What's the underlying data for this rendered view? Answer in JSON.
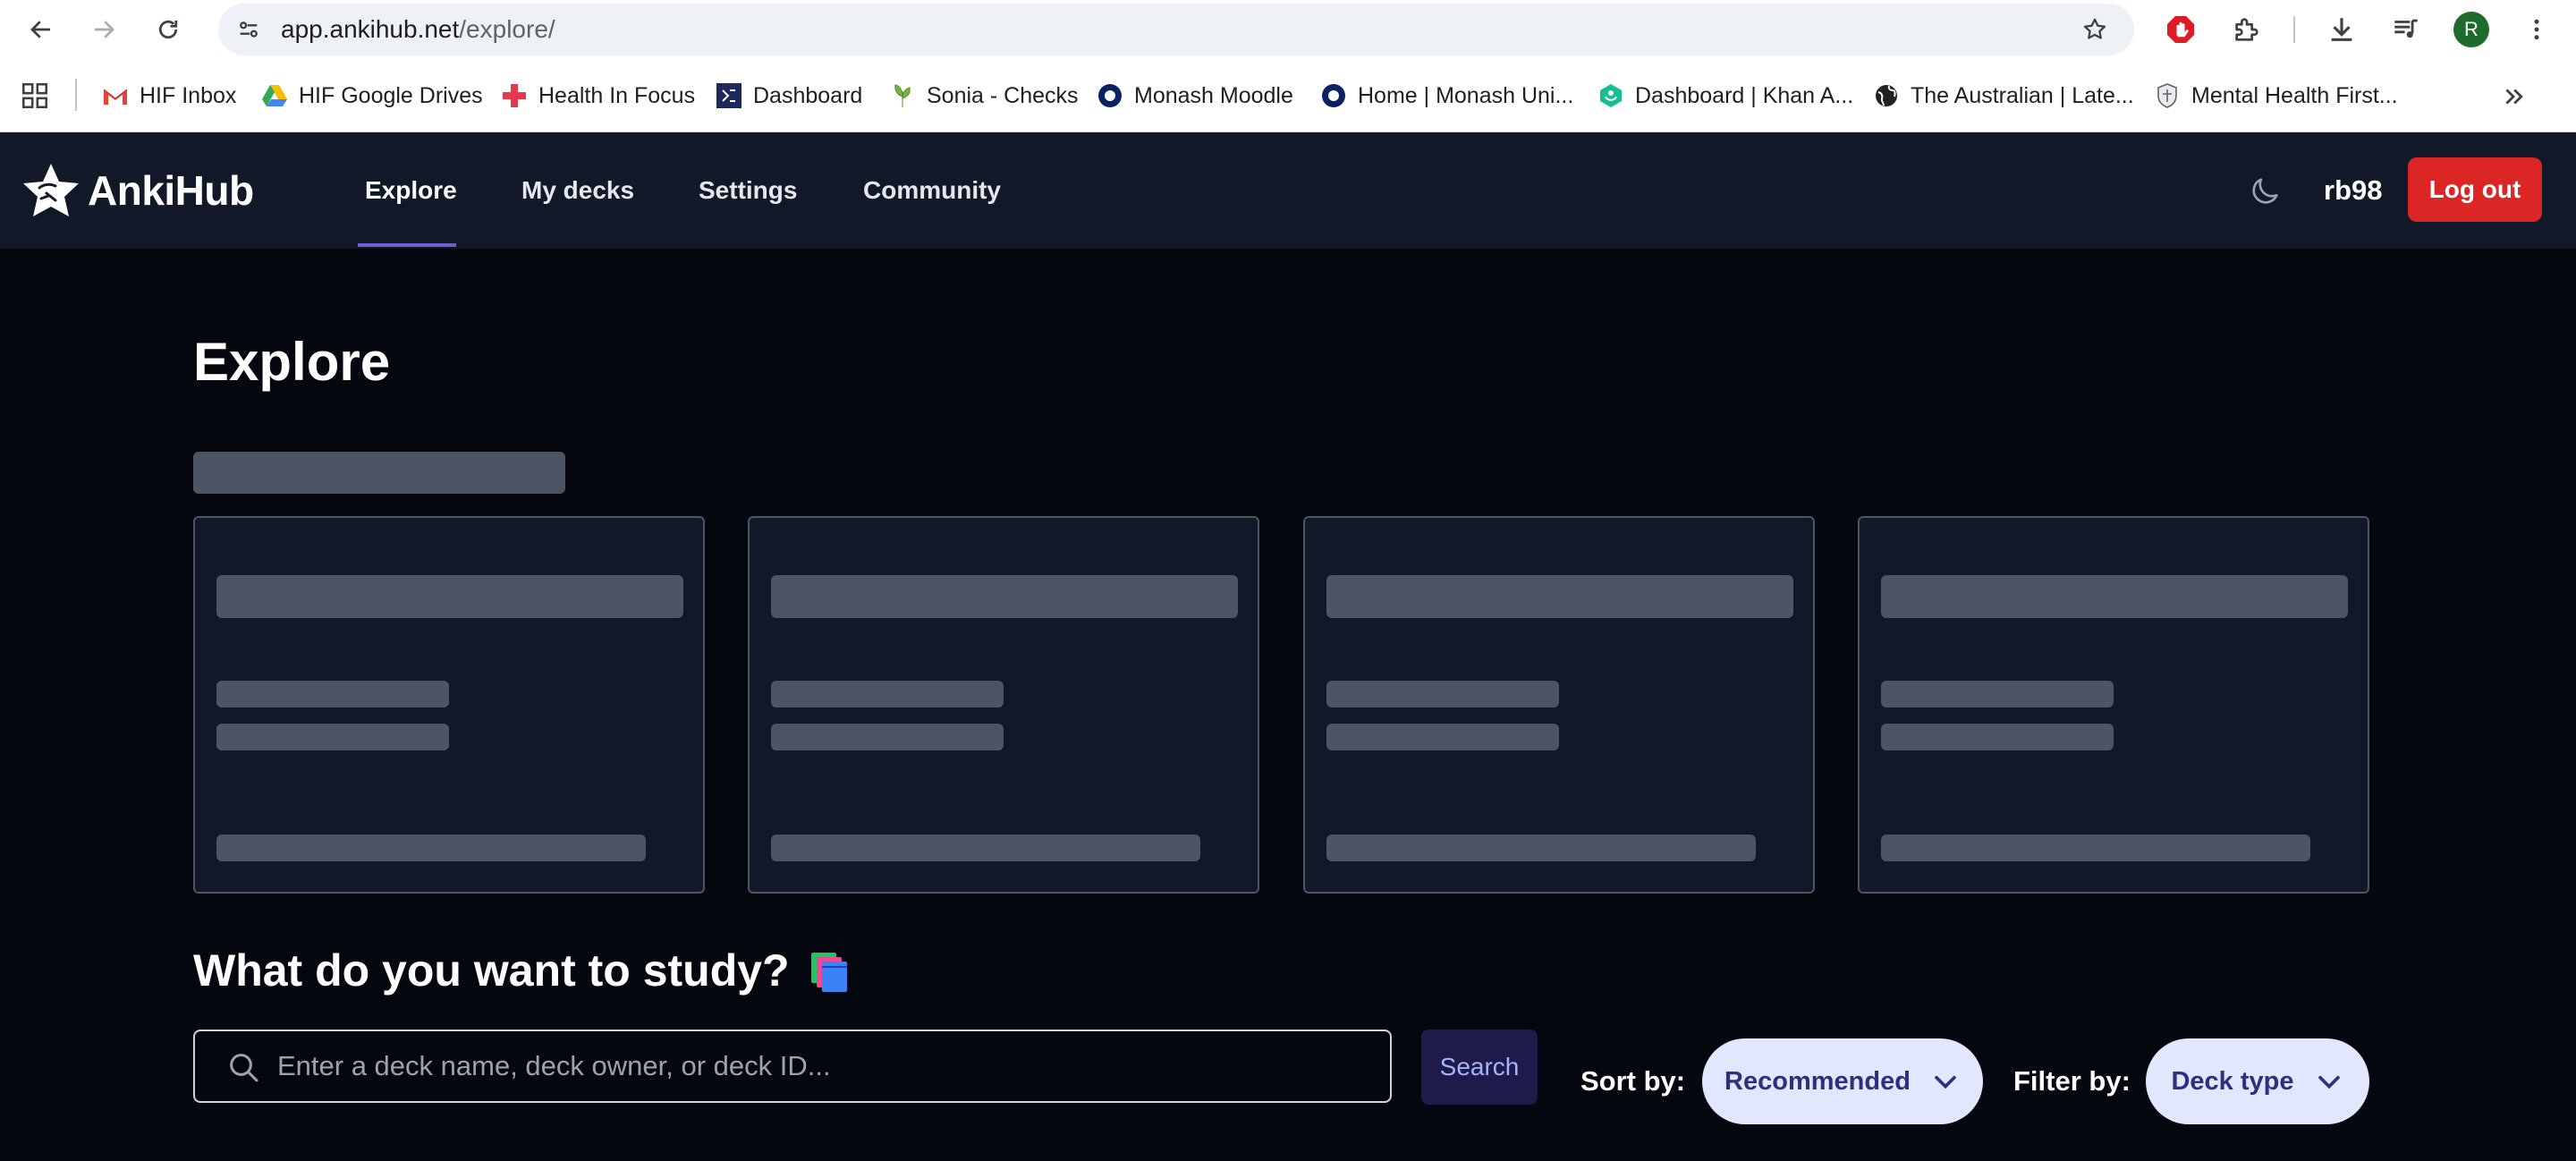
{
  "browser": {
    "url_host": "app.ankihub.net",
    "url_path": "/explore/",
    "avatar_letter": "R"
  },
  "bookmarks": [
    {
      "label": "HIF Inbox",
      "icon": "gmail-icon"
    },
    {
      "label": "HIF Google Drives",
      "icon": "google-drive-icon"
    },
    {
      "label": "Health In Focus",
      "icon": "health-cross-icon"
    },
    {
      "label": "Dashboard",
      "icon": "dashboard-logo-icon"
    },
    {
      "label": "Sonia - Checks",
      "icon": "sonia-leaf-icon"
    },
    {
      "label": "Monash Moodle",
      "icon": "monash-circle-icon"
    },
    {
      "label": "Home | Monash Uni...",
      "icon": "monash-circle-icon"
    },
    {
      "label": "Dashboard | Khan A...",
      "icon": "khan-academy-icon"
    },
    {
      "label": "The Australian | Late...",
      "icon": "globe-icon"
    },
    {
      "label": "Mental Health First...",
      "icon": "shield-crest-icon"
    }
  ],
  "header": {
    "logo_text": "AnkiHub",
    "nav": [
      "Explore",
      "My decks",
      "Settings",
      "Community"
    ],
    "username": "rb98",
    "logout_label": "Log out"
  },
  "main": {
    "title": "Explore",
    "study_heading": "What do you want to study?",
    "search": {
      "placeholder": "Enter a deck name, deck owner, or deck ID...",
      "value": "",
      "button_label": "Search"
    },
    "sort_label": "Sort by:",
    "sort_value": "Recommended",
    "filter_label": "Filter by:",
    "filter_value": "Deck type"
  },
  "colors": {
    "page_bg": "#05070f",
    "header_bg": "#111827",
    "skeleton": "#4b5563",
    "logout": "#dc2626",
    "accent": "#6d5fd3",
    "pill_bg": "#e0e7ff"
  }
}
